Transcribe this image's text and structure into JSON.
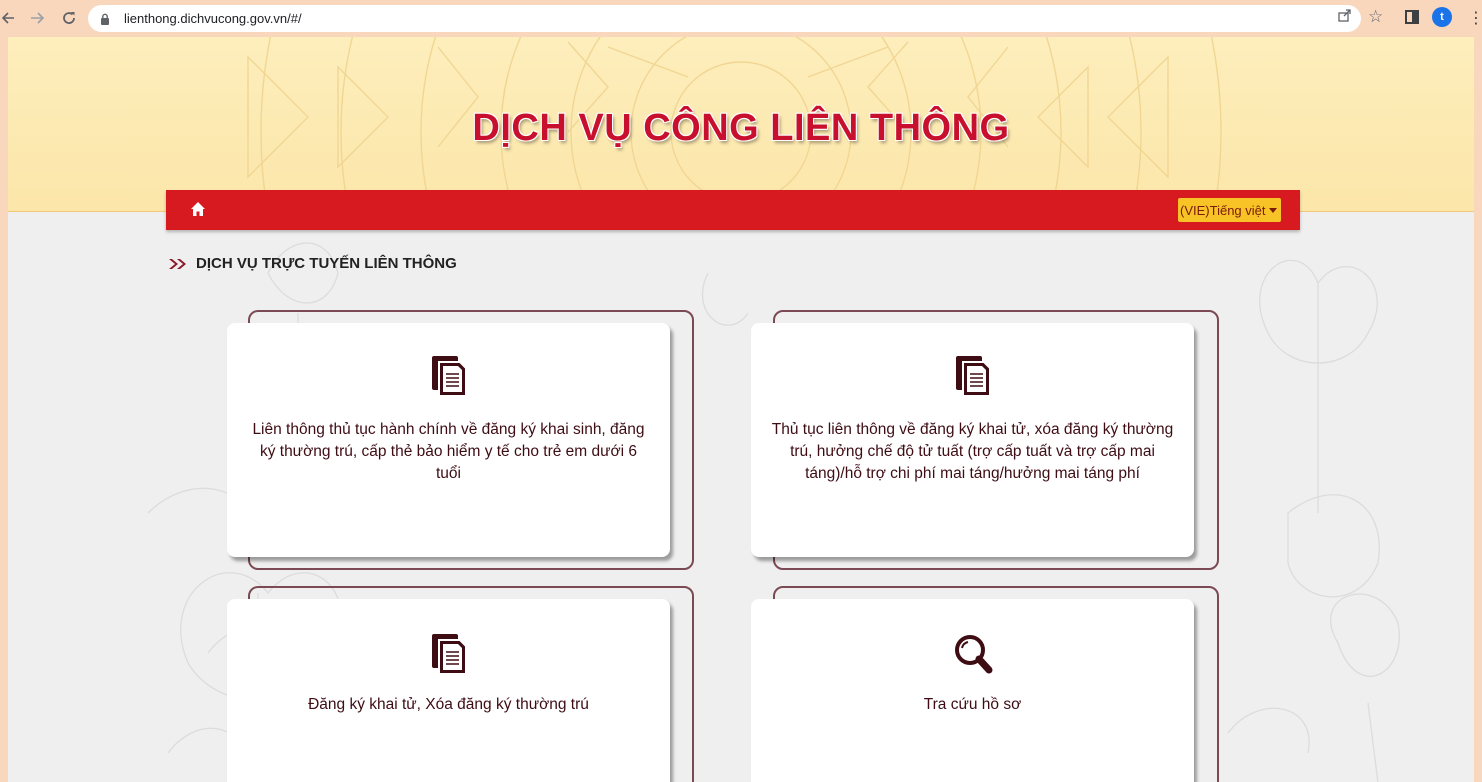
{
  "browser": {
    "url": "lienthong.dichvucong.gov.vn/#/",
    "avatar_letter": "t"
  },
  "site": {
    "title": "DỊCH VỤ CÔNG LIÊN THÔNG",
    "language_selector": "(VIE)Tiếng việt",
    "accent_red": "#d71920",
    "title_red": "#c8102e",
    "lang_bg": "#f7c326",
    "card_frame": "#7b4a54",
    "card_text": "#3e0d14"
  },
  "section": {
    "heading": "DỊCH VỤ TRỰC TUYẾN LIÊN THÔNG"
  },
  "cards": [
    {
      "icon": "document-icon",
      "label": "Liên thông thủ tục hành chính về đăng ký khai sinh, đăng ký thường trú, cấp thẻ bảo hiểm y tế cho trẻ em dưới 6 tuổi"
    },
    {
      "icon": "document-icon",
      "label": "Thủ tục liên thông về đăng ký khai tử, xóa đăng ký thường trú, hưởng chế độ tử tuất (trợ cấp tuất và trợ cấp mai táng)/hỗ trợ chi phí mai táng/hưởng mai táng phí"
    },
    {
      "icon": "document-icon",
      "label": "Đăng ký khai tử, Xóa đăng ký thường trú"
    },
    {
      "icon": "search-icon",
      "label": "Tra cứu hồ sơ"
    }
  ]
}
